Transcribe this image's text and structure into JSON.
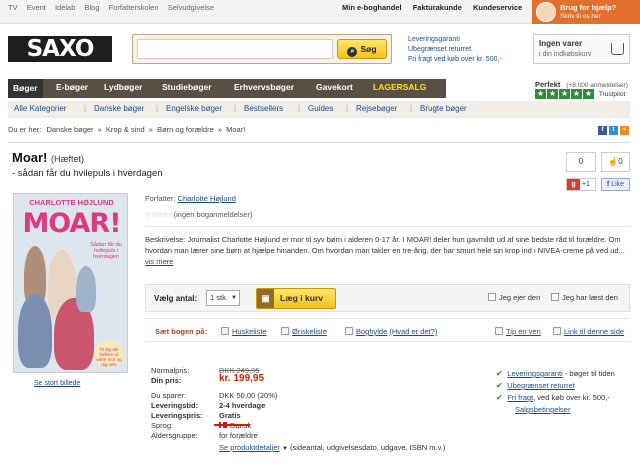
{
  "topbar": {
    "left_links": [
      "TV",
      "Event",
      "Idélab",
      "Blog",
      "Forfatterskolen",
      "Selvudgivelse"
    ],
    "right_links": [
      "Min e-boghandel",
      "Fakturakunde",
      "Kundeservice"
    ],
    "help_title": "Brug for hjælp?",
    "help_sub": "Skriv til os her"
  },
  "header": {
    "logo": "SAXO",
    "search_placeholder": "",
    "search_button": "Søg",
    "guarantee": [
      "Leveringsgaranti",
      "Ubegrænset returret",
      "Fri fragt ved køb over kr. 500,-"
    ],
    "cart_title": "Ingen varer",
    "cart_sub": "i din indkøbskurv"
  },
  "nav": {
    "items": [
      "Bøger",
      "E-bøger",
      "Lydbøger",
      "Studiebøger",
      "Erhvervsbøger",
      "Gavekort",
      "LAGERSALG"
    ]
  },
  "trustpilot": {
    "label": "Perfekt",
    "count": "(+8.000 anmeldelser)",
    "brand": "Trustpilot"
  },
  "subnav": {
    "items": [
      "Alle Kategorier",
      "Danske bøger",
      "Engelske bøger",
      "Bestsellers",
      "Guides",
      "Rejsebøger",
      "Brugte bøger"
    ]
  },
  "breadcrumb": {
    "prefix": "Du er her:",
    "items": [
      "Danske bøger",
      "Krop & sind",
      "Børn og forældre",
      "Moar!"
    ]
  },
  "product": {
    "title": "Moar!",
    "format": "(Hæftet)",
    "subtitle": "- sådan får du hvilepuls i hverdagen",
    "fb_count": "0",
    "like_count": "0",
    "gplus": "+1",
    "like_label": "Like",
    "cover_author": "CHARLOTTE HØJLUND",
    "cover_title": "MOAR!",
    "cover_sub": "Sådan får du hvilepuls i hverdagen",
    "cover_bubble": "Til dig der hellere vil være mor og dig selv",
    "see_big": "Se stort billede",
    "author_label": "Forfatter:",
    "author": "Charlotte Højlund",
    "rating_stars": "☆☆☆☆☆",
    "rating_text": "(ingen boganmeldelser)",
    "description": "Beskrivelse: Journalist Charlotte Højlund er mor til syv børn i alderen 0-17 år. I MOAR! deler hun gavmildt ud af sine bedste råd til forældre. Om hvordan man lærer sine børn at hjælpe hinanden. Om hvordan man takler en tre-årig, der har smurt hele sin krop ind i NIVEA-creme på ved ud...",
    "see_more": "vis mere"
  },
  "buy": {
    "qty_label": "Vælg antal:",
    "qty_value": "1 stk.",
    "add_to_cart": "Læg i kurv",
    "own_label": "Jeg ejer den",
    "read_label": "Jeg har læst den"
  },
  "save": {
    "label": "Sæt bogen på:",
    "wishlist": "Huskeliste",
    "wishes": "Ønskeliste",
    "shelf": "Boghylde",
    "what": "(Hvad er det?)",
    "tip": "Tip en ven",
    "link": "Link til denne side"
  },
  "prices": {
    "normal_label": "Normalpris:",
    "normal_value": "DKK 249,95",
    "din_label": "Din pris:",
    "din_value": "kr. 199,95",
    "save_label": "Du sparer:",
    "save_value": "DKK 50,00 (20%)",
    "delivery_label": "Leveringstid:",
    "delivery_value": "2-4 hverdage",
    "shipping_label": "Leveringspris:",
    "shipping_value": "Gratis",
    "lang_label": "Sprog:",
    "lang_value": "Dansk",
    "age_label": "Aldersgruppe:",
    "age_value": "for forældre",
    "details_link": "Se produktdetaljer",
    "details_text": "(sideantal, udgivelsesdato, udgave, ISBN m.v.)"
  },
  "benefits": {
    "items": [
      {
        "link": "Leveringsgaranti",
        "text": " - bøger til tiden"
      },
      {
        "link": "Ubegrænset returret",
        "text": ""
      },
      {
        "link": "Fri fragt",
        "text": ", ved køb over kr. 500,-"
      }
    ],
    "terms": "Salgsbetingelser"
  },
  "colors": {
    "nav_bg": "#5a4f45",
    "lagersalg": "#ffe200",
    "price_red": "#cc2200",
    "accent_orange": "#e2702c"
  }
}
